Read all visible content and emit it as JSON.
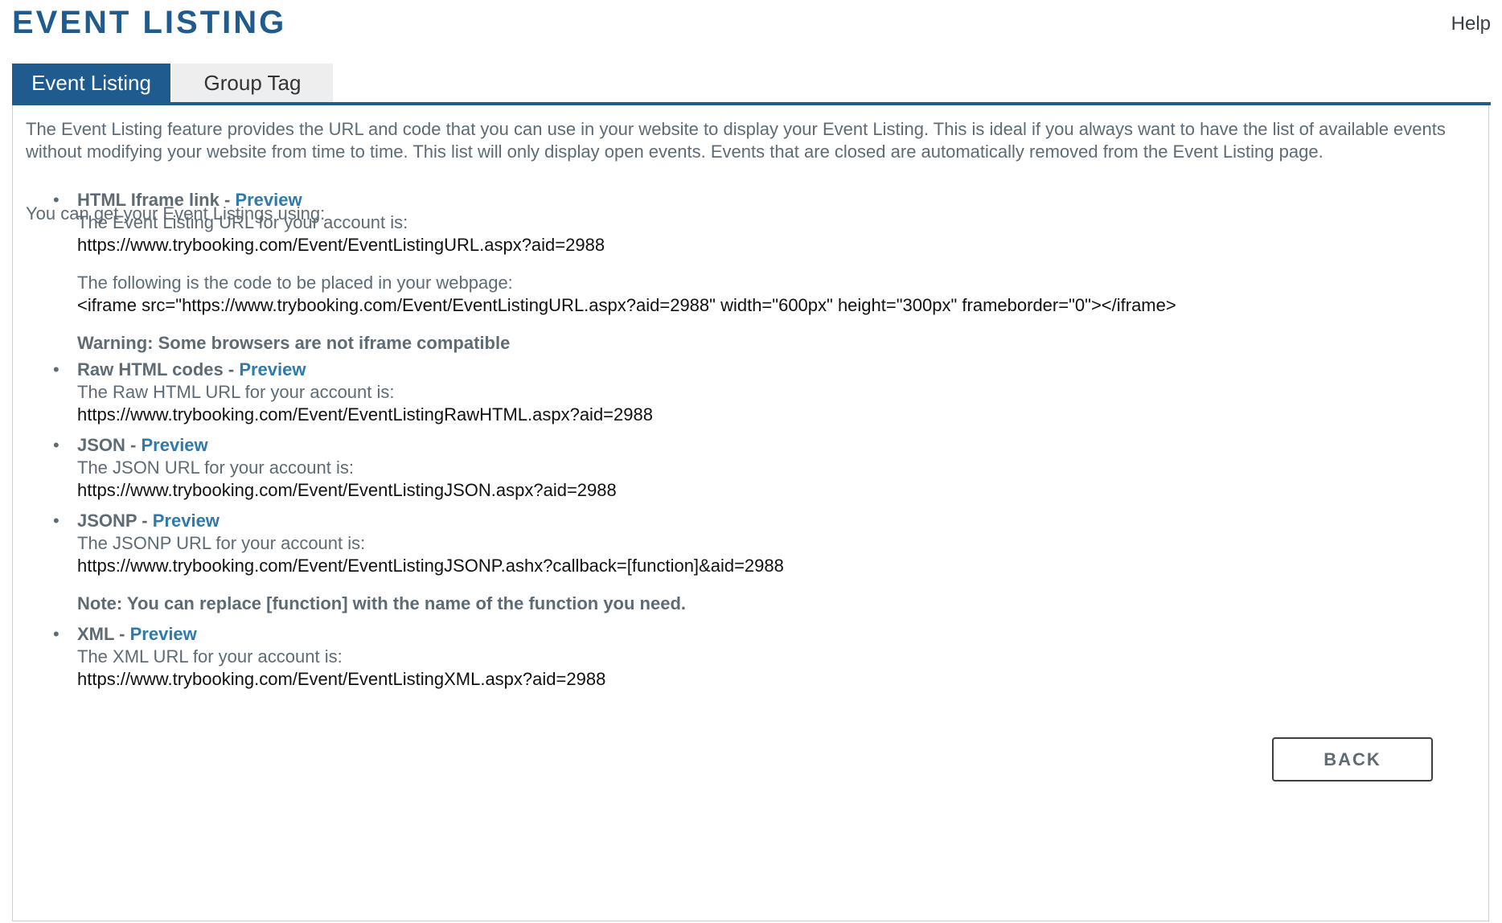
{
  "header": {
    "title": "EVENT LISTING",
    "help_label": "Help"
  },
  "tabs": [
    {
      "label": "Event Listing",
      "active": true
    },
    {
      "label": "Group Tag",
      "active": false
    }
  ],
  "main": {
    "intro": "The Event Listing feature provides the URL and code that you can use in your website to display your Event Listing. This is ideal if you always want to have the list of available events without modifying your website from time to time. This list will only display open events. Events that are closed are automatically removed from the Event Listing page.",
    "get_label": "You can get your Event Listings using:",
    "preview_label": "Preview",
    "items": [
      {
        "title": "HTML Iframe link",
        "url_label": "The Event Listing URL for your account is:",
        "url": "https://www.trybooking.com/Event/EventListingURL.aspx?aid=2988",
        "code_label": "The following is the code to be placed in your webpage:",
        "code": "<iframe src=\"https://www.trybooking.com/Event/EventListingURL.aspx?aid=2988\" width=\"600px\" height=\"300px\" frameborder=\"0\"></iframe>",
        "warning": "Warning: Some browsers are not iframe compatible"
      },
      {
        "title": "Raw HTML codes",
        "url_label": "The Raw HTML URL for your account is:",
        "url": "https://www.trybooking.com/Event/EventListingRawHTML.aspx?aid=2988"
      },
      {
        "title": "JSON",
        "url_label": "The JSON URL for your account is:",
        "url": "https://www.trybooking.com/Event/EventListingJSON.aspx?aid=2988"
      },
      {
        "title": "JSONP",
        "url_label": "The JSONP URL for your account is:",
        "url": "https://www.trybooking.com/Event/EventListingJSONP.ashx?callback=[function]&aid=2988",
        "note": "Note: You can replace [function] with the name of the function you need."
      },
      {
        "title": "XML",
        "url_label": "The XML URL for your account is:",
        "url": "https://www.trybooking.com/Event/EventListingXML.aspx?aid=2988"
      }
    ]
  },
  "footer": {
    "back_label": "BACK"
  },
  "colors": {
    "brand": "#1f5b8e",
    "link": "#2f7aa8",
    "text": "#5f6b74"
  }
}
